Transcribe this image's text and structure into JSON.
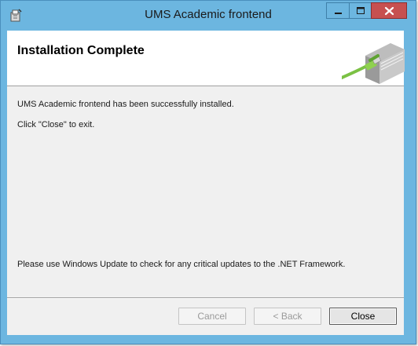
{
  "window": {
    "title": "UMS Academic frontend",
    "icons": {
      "app": "installer-icon",
      "minimize": "minimize-icon",
      "maximize": "maximize-icon",
      "close": "close-icon"
    },
    "colors": {
      "frame": "#6cb6e0",
      "close_button": "#c75050"
    }
  },
  "banner": {
    "title": "Installation Complete",
    "graphic": "book-with-cable-icon"
  },
  "content": {
    "success_message": "UMS Academic frontend has been successfully installed.",
    "exit_hint": "Click \"Close\" to exit.",
    "update_note": "Please use Windows Update to check for any critical updates to the .NET Framework."
  },
  "buttons": {
    "cancel": "Cancel",
    "back": "< Back",
    "close": "Close"
  }
}
